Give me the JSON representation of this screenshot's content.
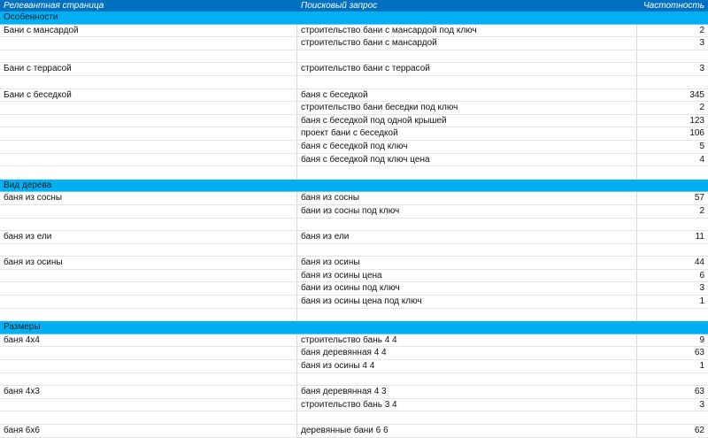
{
  "table": {
    "headers": [
      "Релевантная страница",
      "Поисковый запрос",
      "Частотность"
    ],
    "rows": [
      {
        "type": "section",
        "page": "Особенности",
        "query": "",
        "freq": ""
      },
      {
        "type": "data",
        "page": "Бани с мансардой",
        "query": "строительство бани с мансардой под ключ",
        "freq": "2"
      },
      {
        "type": "data",
        "page": "",
        "query": "строительство бани с мансардой",
        "freq": "3"
      },
      {
        "type": "data",
        "page": "",
        "query": "",
        "freq": ""
      },
      {
        "type": "data",
        "page": "Бани с террасой",
        "query": "строительство бани с террасой",
        "freq": "3"
      },
      {
        "type": "data",
        "page": "",
        "query": "",
        "freq": ""
      },
      {
        "type": "data",
        "page": "Бани с беседкой",
        "query": "баня с беседкой",
        "freq": "345"
      },
      {
        "type": "data",
        "page": "",
        "query": "строительство бани беседки под ключ",
        "freq": "2"
      },
      {
        "type": "data",
        "page": "",
        "query": "баня с беседкой под одной крышей",
        "freq": "123"
      },
      {
        "type": "data",
        "page": "",
        "query": "проект бани с беседкой",
        "freq": "106"
      },
      {
        "type": "data",
        "page": "",
        "query": "баня с беседкой под ключ",
        "freq": "5"
      },
      {
        "type": "data",
        "page": "",
        "query": "баня с беседкой под ключ цена",
        "freq": "4"
      },
      {
        "type": "data",
        "page": "",
        "query": "",
        "freq": ""
      },
      {
        "type": "section",
        "page": "Вид дерева",
        "query": "",
        "freq": ""
      },
      {
        "type": "data",
        "page": "баня из сосны",
        "query": "баня из сосны",
        "freq": "57"
      },
      {
        "type": "data",
        "page": "",
        "query": "бани из сосны под ключ",
        "freq": "2"
      },
      {
        "type": "data",
        "page": "",
        "query": "",
        "freq": ""
      },
      {
        "type": "data",
        "page": "баня из ели",
        "query": "баня из ели",
        "freq": "11"
      },
      {
        "type": "data",
        "page": "",
        "query": "",
        "freq": ""
      },
      {
        "type": "data",
        "page": "баня из осины",
        "query": "баня из осины",
        "freq": "44"
      },
      {
        "type": "data",
        "page": "",
        "query": "баня из осины цена",
        "freq": "6"
      },
      {
        "type": "data",
        "page": "",
        "query": "бани из осины под ключ",
        "freq": "3"
      },
      {
        "type": "data",
        "page": "",
        "query": "баня из осины цена под ключ",
        "freq": "1"
      },
      {
        "type": "data",
        "page": "",
        "query": "",
        "freq": ""
      },
      {
        "type": "section",
        "page": "Размеры",
        "query": "",
        "freq": ""
      },
      {
        "type": "data",
        "page": "баня 4х4",
        "query": "строительство бань 4 4",
        "freq": "9"
      },
      {
        "type": "data",
        "page": "",
        "query": "баня деревянная 4 4",
        "freq": "63"
      },
      {
        "type": "data",
        "page": "",
        "query": "баня из осины 4 4",
        "freq": "1"
      },
      {
        "type": "data",
        "page": "",
        "query": "",
        "freq": ""
      },
      {
        "type": "data",
        "page": "баня 4х3",
        "query": "баня деревянная 4 3",
        "freq": "63"
      },
      {
        "type": "data",
        "page": "",
        "query": "строительство бань 3 4",
        "freq": "3"
      },
      {
        "type": "data",
        "page": "",
        "query": "",
        "freq": ""
      },
      {
        "type": "data",
        "page": "баня 6х6",
        "query": "деревянные бани 6 6",
        "freq": "62"
      }
    ]
  },
  "colors": {
    "header_bg": "#0070c0",
    "section_bg": "#00b0f0",
    "grid_line": "#d9d9d9"
  }
}
